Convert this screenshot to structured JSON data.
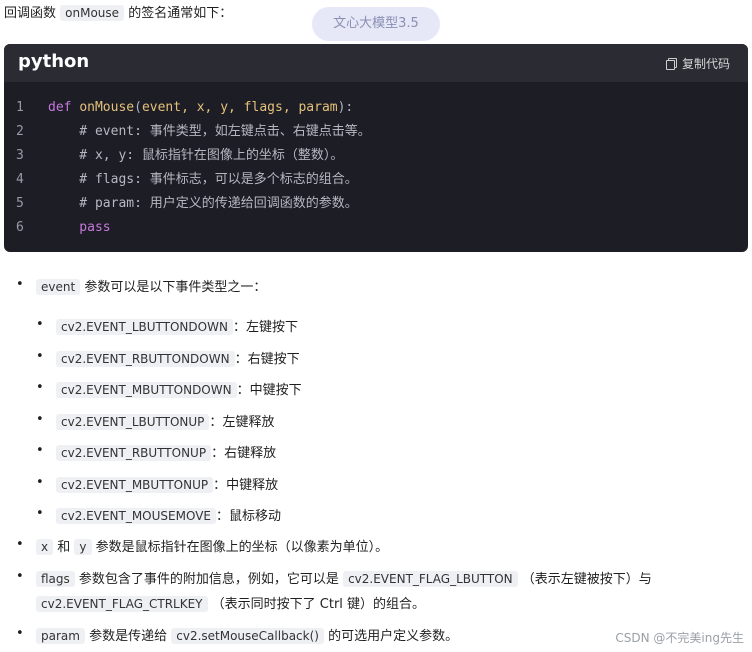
{
  "intro": {
    "prefix": "回调函数",
    "code": "onMouse",
    "suffix": "的签名通常如下："
  },
  "model_badge": "文心大模型3.5",
  "codeblock": {
    "language": "python",
    "copy_label": "复制代码",
    "lines": [
      {
        "n": "1",
        "parts": [
          [
            "kw",
            "def "
          ],
          [
            "fn",
            "onMouse"
          ],
          [
            "pl",
            "("
          ],
          [
            "pr",
            "event, x, y, flags, param"
          ],
          [
            "pl",
            "):"
          ]
        ]
      },
      {
        "n": "2",
        "parts": [
          [
            "cm",
            "    # event: 事件类型，如左键点击、右键点击等。"
          ]
        ]
      },
      {
        "n": "3",
        "parts": [
          [
            "cm",
            "    # x, y: 鼠标指针在图像上的坐标（整数）。"
          ]
        ]
      },
      {
        "n": "4",
        "parts": [
          [
            "cm",
            "    # flags: 事件标志，可以是多个标志的组合。"
          ]
        ]
      },
      {
        "n": "5",
        "parts": [
          [
            "cm",
            "    # param: 用户定义的传递给回调函数的参数。"
          ]
        ]
      },
      {
        "n": "6",
        "parts": [
          [
            "pass",
            "    pass"
          ]
        ]
      }
    ]
  },
  "event_bullet": {
    "code": "event",
    "text": "参数可以是以下事件类型之一："
  },
  "events": [
    {
      "code": "cv2.EVENT_LBUTTONDOWN",
      "desc": "左键按下"
    },
    {
      "code": "cv2.EVENT_RBUTTONDOWN",
      "desc": "右键按下"
    },
    {
      "code": "cv2.EVENT_MBUTTONDOWN",
      "desc": "中键按下"
    },
    {
      "code": "cv2.EVENT_LBUTTONUP",
      "desc": "左键释放"
    },
    {
      "code": "cv2.EVENT_RBUTTONUP",
      "desc": "右键释放"
    },
    {
      "code": "cv2.EVENT_MBUTTONUP",
      "desc": "中键释放"
    },
    {
      "code": "cv2.EVENT_MOUSEMOVE",
      "desc": "鼠标移动"
    }
  ],
  "xy_bullet": {
    "x": "x",
    "and": "和",
    "y": "y",
    "text": "参数是鼠标指针在图像上的坐标（以像素为单位）。"
  },
  "flags_bullet": {
    "code": "flags",
    "text1": "参数包含了事件的附加信息，例如，它可以是",
    "code2": "cv2.EVENT_FLAG_LBUTTON",
    "text2": "（表示左键被按下）与",
    "code3": "cv2.EVENT_FLAG_CTRLKEY",
    "text3": "（表示同时按下了 Ctrl 键）的组合。"
  },
  "param_bullet": {
    "code": "param",
    "text1": "参数是传递给",
    "code2": "cv2.setMouseCallback()",
    "text2": "的可选用户定义参数。"
  },
  "watermark": "CSDN @不完美ing先生"
}
